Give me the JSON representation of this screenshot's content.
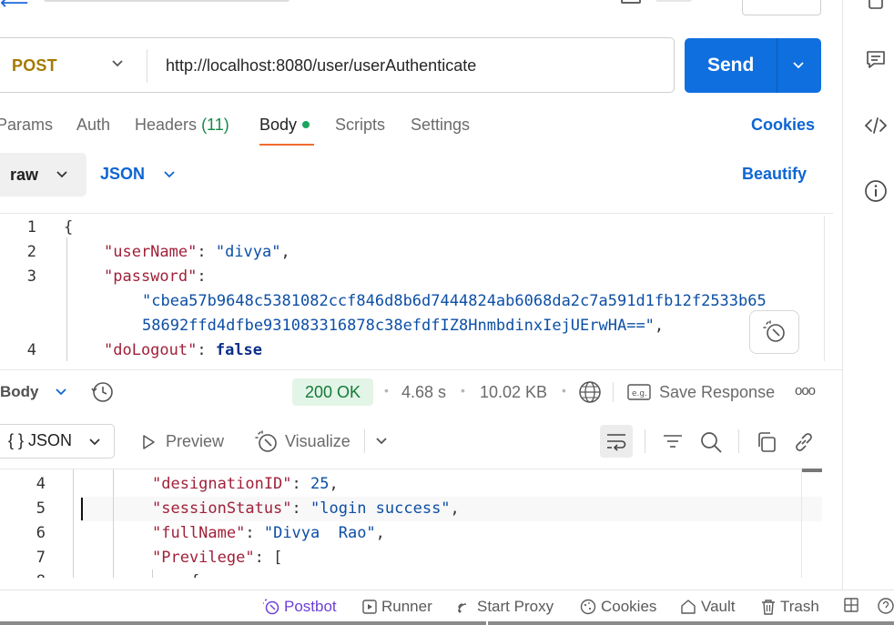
{
  "request": {
    "method": "POST",
    "url": "http://localhost:8080/user/userAuthenticate",
    "send_label": "Send",
    "tabs": [
      {
        "label": "Params"
      },
      {
        "label": "Auth"
      },
      {
        "label": "Headers",
        "count": "(11)"
      },
      {
        "label": "Body",
        "active": true
      },
      {
        "label": "Scripts"
      },
      {
        "label": "Settings"
      }
    ],
    "cookies_label": "Cookies",
    "body_mode": "raw",
    "body_format": "JSON",
    "beautify_label": "Beautify",
    "lines": {
      "n1": "1",
      "n2": "2",
      "n3": "3",
      "n4": "4",
      "open_brace": "{",
      "k_username": "\"userName\"",
      "v_username": "\"divya\"",
      "k_password": "\"password\"",
      "v_password_1": "\"cbea57b9648c5381082ccf846d8b6d7444824ab6068da2c7a591d1fb12f2533b65",
      "v_password_2": "58692ffd4dfbe931083316878c38efdfIZ8HnmbdinxIejUErwHA==\"",
      "k_dologout": "\"doLogout\"",
      "v_dologout": "false"
    }
  },
  "response": {
    "body_label": "Body",
    "status": "200 OK",
    "time": "4.68 s",
    "size": "10.02 KB",
    "save_label": "Save Response",
    "more_label": "ooo",
    "format_label": "{ } JSON",
    "preview_label": "Preview",
    "visualize_label": "Visualize",
    "lines": {
      "n4": "4",
      "n5": "5",
      "n6": "6",
      "n7": "7",
      "n8": "8",
      "k_designation": "\"designationID\"",
      "v_designation": "25",
      "k_session": "\"sessionStatus\"",
      "v_session": "\"login success\"",
      "k_fullname": "\"fullName\"",
      "v_fullname": "\"Divya  Rao\"",
      "k_previlege": "\"Previlege\"",
      "v_previlege": "[",
      "next_brace": "{"
    }
  },
  "statusbar": {
    "postbot": "Postbot",
    "runner": "Runner",
    "proxy": "Start Proxy",
    "cookies": "Cookies",
    "vault": "Vault",
    "trash": "Trash"
  },
  "colors": {
    "accent": "#0f6fde",
    "method": "#a37b00",
    "status_ok_bg": "#e3f5e6",
    "status_ok_text": "#127a3a",
    "tab_underline": "#f06b2f",
    "postbot": "#6d3fd6"
  }
}
